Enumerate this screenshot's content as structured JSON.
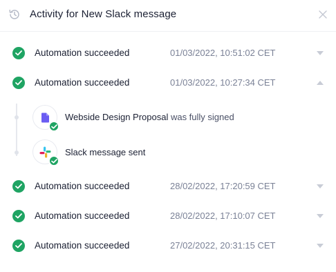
{
  "header": {
    "title": "Activity for New Slack message"
  },
  "activities": [
    {
      "label": "Automation succeeded",
      "time": "01/03/2022, 10:51:02 CET",
      "expanded": false
    },
    {
      "label": "Automation succeeded",
      "time": "01/03/2022, 10:27:34 CET",
      "expanded": true
    },
    {
      "label": "Automation succeeded",
      "time": "28/02/2022, 17:20:59 CET",
      "expanded": false
    },
    {
      "label": "Automation succeeded",
      "time": "28/02/2022, 17:10:07 CET",
      "expanded": false
    },
    {
      "label": "Automation succeeded",
      "time": "27/02/2022, 20:31:15 CET",
      "expanded": false
    }
  ],
  "steps": [
    {
      "icon": "document-icon",
      "name": "Webside Design Proposal",
      "suffix": " was fully signed"
    },
    {
      "icon": "slack-icon",
      "name": "Slack message sent",
      "suffix": ""
    }
  ],
  "colors": {
    "success": "#1fa463",
    "document": "#6a5cf2",
    "muted": "#7a8196"
  }
}
